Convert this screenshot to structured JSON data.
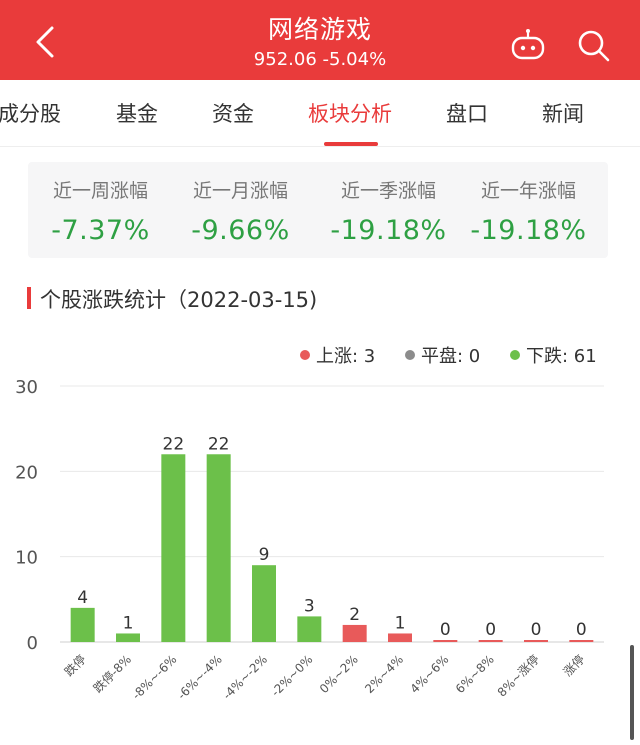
{
  "header": {
    "title": "网络游戏",
    "price": "952.06",
    "change": "-5.04%",
    "bg_color": "#e93b3b",
    "icons": [
      "back-arrow-icon",
      "robot-icon",
      "search-icon"
    ]
  },
  "tabs": [
    {
      "label": "成分股"
    },
    {
      "label": "基金"
    },
    {
      "label": "资金"
    },
    {
      "label": "板块分析",
      "active": true
    },
    {
      "label": "盘口"
    },
    {
      "label": "新闻"
    }
  ],
  "stats": [
    {
      "label": "近一周涨幅",
      "value": "-7.37%"
    },
    {
      "label": "近一月涨幅",
      "value": "-9.66%"
    },
    {
      "label": "近一季涨幅",
      "value": "-19.18%"
    },
    {
      "label": "近一年涨幅",
      "value": "-19.18%"
    }
  ],
  "section": {
    "title": "个股涨跌统计（2022-03-15)"
  },
  "legend": [
    {
      "label": "上涨: 3",
      "color": "#e85a5a"
    },
    {
      "label": "平盘: 0",
      "color": "#8c8c8c"
    },
    {
      "label": "下跌: 61",
      "color": "#6cc04a"
    }
  ],
  "chart_data": {
    "type": "bar",
    "categories": [
      "跌停",
      "跌停-8%",
      "-8%~-6%",
      "-6%~-4%",
      "-4%~-2%",
      "-2%~0%",
      "0%~2%",
      "2%~4%",
      "4%~6%",
      "6%~8%",
      "8%~涨停",
      "涨停"
    ],
    "values": [
      4,
      1,
      22,
      22,
      9,
      3,
      2,
      1,
      0,
      0,
      0,
      0
    ],
    "colors": [
      "#6cc04a",
      "#6cc04a",
      "#6cc04a",
      "#6cc04a",
      "#6cc04a",
      "#6cc04a",
      "#e85a5a",
      "#e85a5a",
      "#e85a5a",
      "#e85a5a",
      "#e85a5a",
      "#e85a5a"
    ],
    "yticks": [
      0,
      10,
      20,
      30
    ],
    "ylim": [
      0,
      30
    ],
    "grid": true
  }
}
